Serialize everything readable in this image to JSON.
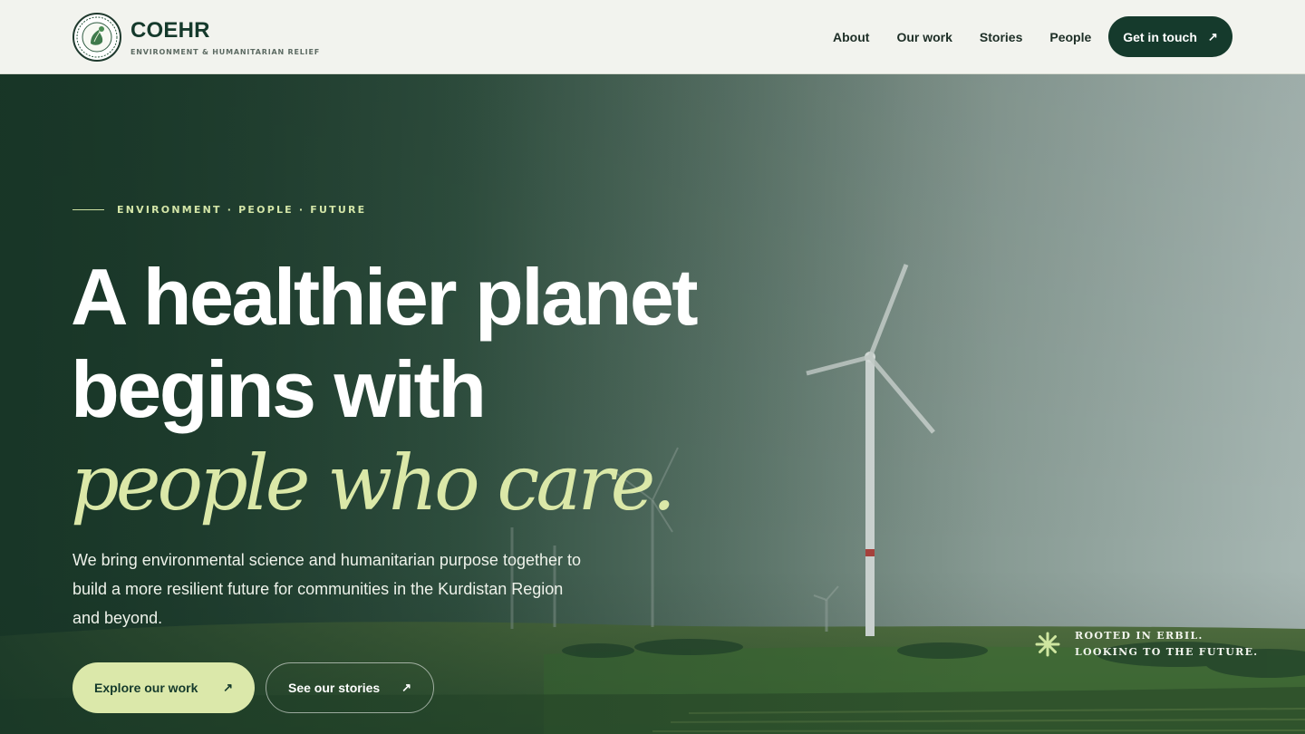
{
  "brand": {
    "name": "COEHR",
    "tagline": "ENVIRONMENT & HUMANITARIAN RELIEF"
  },
  "nav": {
    "items": [
      {
        "label": "About"
      },
      {
        "label": "Our work"
      },
      {
        "label": "Stories"
      },
      {
        "label": "People"
      }
    ],
    "cta_label": "Get in touch",
    "cta_icon": "arrow-up-right-icon"
  },
  "hero": {
    "eyebrow": "ENVIRONMENT · PEOPLE · FUTURE",
    "headline_line1": "A healthier planet",
    "headline_line2": "begins with",
    "headline_accent": "people who care.",
    "lead": "We bring environmental science and humanitarian purpose together to build a more resilient future for communities in the Kurdistan Region and beyond.",
    "primary_button": "Explore our work",
    "secondary_button": "See our stories",
    "badge_line1": "ROOTED IN ERBIL.",
    "badge_line2": "LOOKING TO THE FUTURE.",
    "badge_icon": "asterisk-icon"
  },
  "colors": {
    "brand_dark": "#153a2c",
    "accent_lime": "#dbe8aa",
    "header_bg": "#f2f3ee"
  }
}
